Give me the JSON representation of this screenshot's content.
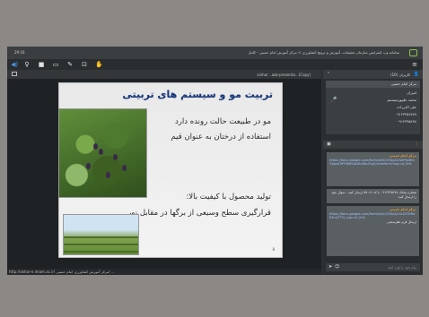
{
  "topbar": {
    "clock": "29:16",
    "title": "سامانه وب کنفرانس سازمان تحقیقات، آموزش و ترویج کشاورزی > مرکز آموزش امام خمینی - کامل"
  },
  "toolbar": {
    "icons": [
      "speaker-icon",
      "mic-icon",
      "camera-icon",
      "screen-share-icon",
      "pen-icon",
      "whiteboard-icon",
      "raise-hand-icon",
      "menu-icon"
    ]
  },
  "stage": {
    "document_name": "sinhar ..aak-presenta...(Copy)",
    "slide": {
      "title": "تربیت مو و سیستم های تربیتی",
      "lines": [
        "مو در طبیعت حالت رونده دارد",
        "استفاده از درختان به عنوان قیم",
        "تولید محصول با کیفیت بالا:",
        "قرارگیری سطح وسیعی از برگها در مقابل نور"
      ],
      "page_number": "8"
    },
    "status_url": "http://akhar-e.imam.ac.ir/ مرکز آموزش کشاورزی امام خمینی/ ... "
  },
  "users": {
    "header": "کاربران (10)",
    "list": [
      "مرکز امام خمینی",
      "امیران",
      "محمد علیپورسیستم",
      "علی اکبرزاده",
      "۰۹۱۲۳۴۵۶۷۸۹",
      "۰۹۱۲۳۴۵۶۷۸"
    ]
  },
  "chat": {
    "messages": [
      {
        "name": "مرکز امام خمینی",
        "link": "https://docs.google.com/forms/d/e/1FAIpQLSeF9gHmGkpwJTrPFBWSdLWnBbuOgZ/viewform?usp=sf_link",
        "text": ""
      },
      {
        "name": "",
        "link": "",
        "text": "شماره پیامک ۰۹۱۲۳۴۵۶۷۸ با کد ۵۷۰۸۱ ارسال کنید ، سوال خود را ارسال کنید"
      },
      {
        "name": "مرکز امام خمینی",
        "link": "https://docs.google.com/forms/d/e/1FAIpQLScD5ToRdE4cqTTTz_usp=sf_link",
        "text": "ارسال فرم نظرسنجی"
      }
    ],
    "input_placeholder": "پیام خود را وارد کنید"
  },
  "colors": {
    "accent": "#4a90e2",
    "chat_name": "#f0a020",
    "slide_title": "#17387a"
  }
}
